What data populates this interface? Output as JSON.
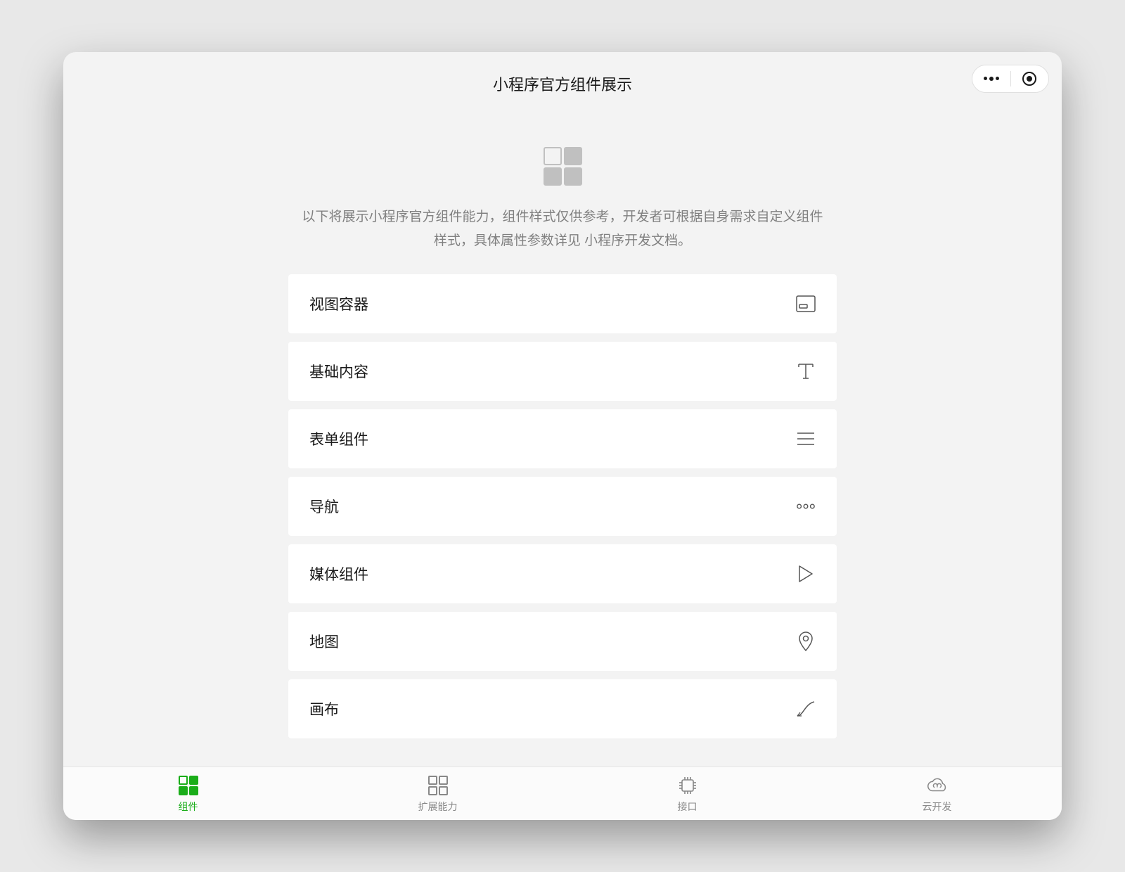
{
  "header": {
    "title": "小程序官方组件展示"
  },
  "intro": {
    "description": "以下将展示小程序官方组件能力，组件样式仅供参考，开发者可根据自身需求自定义组件样式，具体属性参数详见 小程序开发文档。"
  },
  "menu": {
    "items": [
      {
        "label": "视图容器",
        "icon": "container-icon"
      },
      {
        "label": "基础内容",
        "icon": "text-icon"
      },
      {
        "label": "表单组件",
        "icon": "list-lines-icon"
      },
      {
        "label": "导航",
        "icon": "dots-horizontal-icon"
      },
      {
        "label": "媒体组件",
        "icon": "play-icon"
      },
      {
        "label": "地图",
        "icon": "map-pin-icon"
      },
      {
        "label": "画布",
        "icon": "curve-icon"
      }
    ]
  },
  "tabbar": {
    "items": [
      {
        "label": "组件",
        "icon": "grid-icon",
        "active": true
      },
      {
        "label": "扩展能力",
        "icon": "grid-outline-icon",
        "active": false
      },
      {
        "label": "接口",
        "icon": "chip-icon",
        "active": false
      },
      {
        "label": "云开发",
        "icon": "cloud-icon",
        "active": false
      }
    ]
  }
}
